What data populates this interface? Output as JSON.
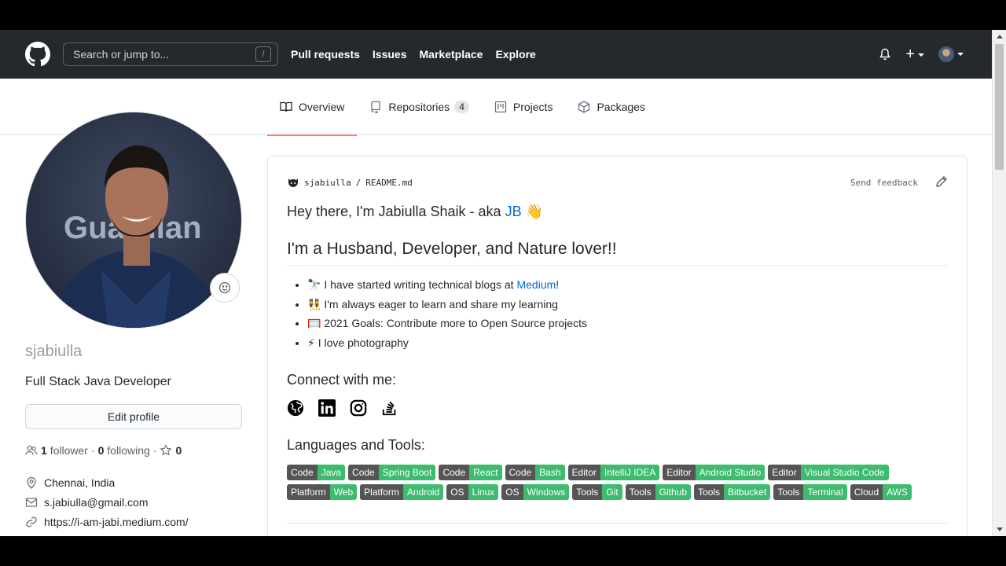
{
  "header": {
    "search_placeholder": "Search or jump to...",
    "search_shortcut": "/",
    "nav": [
      "Pull requests",
      "Issues",
      "Marketplace",
      "Explore"
    ],
    "plus": "+"
  },
  "tabs": [
    {
      "label": "Overview",
      "active": true
    },
    {
      "label": "Repositories",
      "count": "4"
    },
    {
      "label": "Projects"
    },
    {
      "label": "Packages"
    }
  ],
  "profile": {
    "photo_text": "Guardian",
    "username": "sjabiulla",
    "bio": "Full Stack Java Developer",
    "edit_label": "Edit profile",
    "followers_count": "1",
    "followers_label": "follower",
    "sep": "·",
    "following_count": "0",
    "following_label": "following",
    "stars_sep": "·",
    "stars_count": "0",
    "location": "Chennai, India",
    "email": "s.jabiulla@gmail.com",
    "website": "https://i-am-jabi.medium.com/"
  },
  "readme": {
    "owner": "sjabiulla",
    "slash": "/",
    "file": "README.md",
    "feedback": "Send feedback",
    "greeting_prefix": "Hey there, I'm Jabiulla Shaik - aka",
    "greeting_link": "JB",
    "greeting_emoji": "👋",
    "heading": "I'm a Husband, Developer, and Nature lover!!",
    "items": [
      {
        "emoji": "🔭",
        "text": "I have started writing technical blogs at",
        "link": "Medium",
        "suffix": "!"
      },
      {
        "emoji": "👯",
        "text": "I'm always eager to learn and share my learning"
      },
      {
        "emoji": "🥅",
        "text": "2021 Goals: Contribute more to Open Source projects"
      },
      {
        "emoji": "⚡",
        "text": "I love photography"
      }
    ],
    "connect_heading": "Connect with me:",
    "social_icons": [
      "globe-icon",
      "linkedin-icon",
      "instagram-icon",
      "stackoverflow-icon"
    ],
    "languages_heading": "Languages and Tools:",
    "badges": [
      {
        "k": "Code",
        "v": "Java"
      },
      {
        "k": "Code",
        "v": "Spring Boot"
      },
      {
        "k": "Code",
        "v": "React"
      },
      {
        "k": "Code",
        "v": "Bash"
      },
      {
        "k": "Editor",
        "v": "IntelliJ IDEA"
      },
      {
        "k": "Editor",
        "v": "Android Studio"
      },
      {
        "k": "Editor",
        "v": "Visual Studio Code"
      },
      {
        "k": "Platform",
        "v": "Web"
      },
      {
        "k": "Platform",
        "v": "Android"
      },
      {
        "k": "OS",
        "v": "Linux"
      },
      {
        "k": "OS",
        "v": "Windows"
      },
      {
        "k": "Tools",
        "v": "Git"
      },
      {
        "k": "Tools",
        "v": "Github"
      },
      {
        "k": "Tools",
        "v": "Bitbucket"
      },
      {
        "k": "Tools",
        "v": "Terminal"
      },
      {
        "k": "Cloud",
        "v": "AWS"
      }
    ]
  },
  "colors": {
    "header_bg": "#24292e",
    "badge_value": "#3dbb6e",
    "badge_key": "#555555",
    "link": "#0366d6",
    "tab_underline": "#f9826c"
  }
}
